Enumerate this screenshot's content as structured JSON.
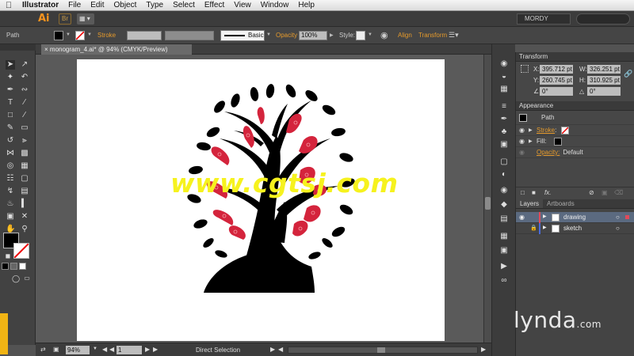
{
  "menubar": {
    "app_name": "Illustrator",
    "items": [
      "File",
      "Edit",
      "Object",
      "Type",
      "Select",
      "Effect",
      "View",
      "Window",
      "Help"
    ]
  },
  "appbar": {
    "logo": "Ai",
    "bridge": "Br",
    "workspace": "MORDY"
  },
  "controlbar": {
    "selection_type": "Path",
    "stroke_label": "Stroke",
    "brush_label": "Basic",
    "opacity_label": "Opacity",
    "opacity_value": "100%",
    "style_label": "Style:",
    "align_label": "Align",
    "transform_label": "Transform"
  },
  "document": {
    "tab_title": "monogram_4.ai* @ 94% (CMYK/Preview)"
  },
  "statusbar": {
    "zoom": "94%",
    "artboard_number": "1",
    "tool_name": "Direct Selection"
  },
  "transform_panel": {
    "title": "Transform",
    "x_label": "X:",
    "x_value": "395.712 pt",
    "y_label": "Y:",
    "y_value": "260.745 pt",
    "w_label": "W:",
    "w_value": "326.251 pt",
    "h_label": "H:",
    "h_value": "310.925 pt",
    "rotate_value": "0°",
    "shear_value": "0°"
  },
  "appearance_panel": {
    "title": "Appearance",
    "object": "Path",
    "stroke_label": "Stroke",
    "stroke_sep": ":",
    "fill_label": "Fill:",
    "opacity_label": "Opacity:",
    "opacity_value": "Default",
    "fx": "fx."
  },
  "layers_panel": {
    "tab_layers": "Layers",
    "tab_artboards": "Artboards",
    "layers": [
      {
        "name": "drawing",
        "color": "#e04a5a"
      },
      {
        "name": "sketch",
        "color": "#4a6ad8"
      }
    ]
  },
  "watermark": "www.cgtsj.com",
  "brand": "lynda",
  "brand_suffix": ".com",
  "colors": {
    "accent": "#e59a2c",
    "tree_red": "#d4243c",
    "watermark": "#f6f21e"
  }
}
